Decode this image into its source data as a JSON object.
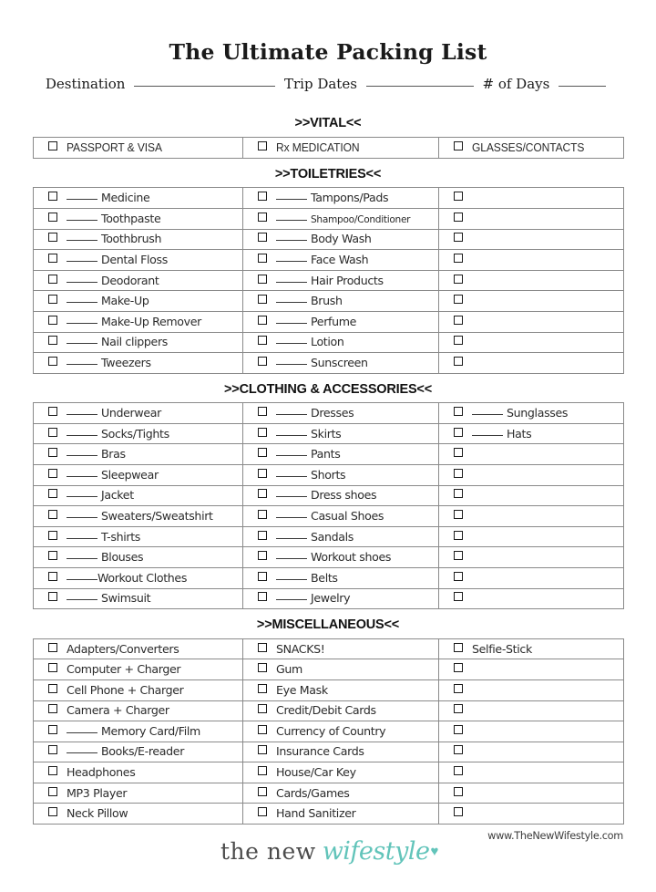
{
  "document": {
    "title": "The Ultimate Packing List",
    "meta": {
      "destination_label": "Destination",
      "trip_dates_label": "Trip Dates",
      "days_label": "# of Days",
      "destination_value": "",
      "trip_dates_value": "",
      "days_value": ""
    }
  },
  "sections": [
    {
      "id": "vital",
      "heading": ">>VITAL<<",
      "style": "caps",
      "rows": [
        [
          {
            "label": "PASSPORT & VISA",
            "blank": false
          },
          {
            "label": "Rx MEDICATION",
            "blank": false
          },
          {
            "label": "GLASSES/CONTACTS",
            "blank": false
          }
        ]
      ]
    },
    {
      "id": "toiletries",
      "heading": ">>TOILETRIES<<",
      "style": "normal",
      "rows": [
        [
          {
            "label": "Medicine",
            "blank": true
          },
          {
            "label": "Tampons/Pads",
            "blank": true
          },
          {
            "label": "",
            "blank": false
          }
        ],
        [
          {
            "label": "Toothpaste",
            "blank": true
          },
          {
            "label": "Shampoo/Conditioner",
            "blank": true,
            "small": true
          },
          {
            "label": "",
            "blank": false
          }
        ],
        [
          {
            "label": "Toothbrush",
            "blank": true
          },
          {
            "label": "Body Wash",
            "blank": true
          },
          {
            "label": "",
            "blank": false
          }
        ],
        [
          {
            "label": "Dental Floss",
            "blank": true
          },
          {
            "label": "Face Wash",
            "blank": true
          },
          {
            "label": "",
            "blank": false
          }
        ],
        [
          {
            "label": "Deodorant",
            "blank": true
          },
          {
            "label": "Hair Products",
            "blank": true
          },
          {
            "label": "",
            "blank": false
          }
        ],
        [
          {
            "label": "Make-Up",
            "blank": true
          },
          {
            "label": "Brush",
            "blank": true
          },
          {
            "label": "",
            "blank": false
          }
        ],
        [
          {
            "label": "Make-Up Remover",
            "blank": true
          },
          {
            "label": "Perfume",
            "blank": true
          },
          {
            "label": "",
            "blank": false
          }
        ],
        [
          {
            "label": "Nail clippers",
            "blank": true
          },
          {
            "label": "Lotion",
            "blank": true
          },
          {
            "label": "",
            "blank": false
          }
        ],
        [
          {
            "label": "Tweezers",
            "blank": true
          },
          {
            "label": "Sunscreen",
            "blank": true
          },
          {
            "label": "",
            "blank": false
          }
        ]
      ]
    },
    {
      "id": "clothing",
      "heading": ">>CLOTHING & ACCESSORIES<<",
      "style": "normal",
      "rows": [
        [
          {
            "label": "Underwear",
            "blank": true
          },
          {
            "label": "Dresses",
            "blank": true
          },
          {
            "label": "Sunglasses",
            "blank": true
          }
        ],
        [
          {
            "label": "Socks/Tights",
            "blank": true
          },
          {
            "label": "Skirts",
            "blank": true
          },
          {
            "label": "Hats",
            "blank": true
          }
        ],
        [
          {
            "label": "Bras",
            "blank": true
          },
          {
            "label": "Pants",
            "blank": true
          },
          {
            "label": "",
            "blank": false
          }
        ],
        [
          {
            "label": "Sleepwear",
            "blank": true
          },
          {
            "label": "Shorts",
            "blank": true
          },
          {
            "label": "",
            "blank": false
          }
        ],
        [
          {
            "label": "Jacket",
            "blank": true
          },
          {
            "label": "Dress shoes",
            "blank": true
          },
          {
            "label": "",
            "blank": false
          }
        ],
        [
          {
            "label": "Sweaters/Sweatshirt",
            "blank": true
          },
          {
            "label": "Casual Shoes",
            "blank": true
          },
          {
            "label": "",
            "blank": false
          }
        ],
        [
          {
            "label": "T-shirts",
            "blank": true
          },
          {
            "label": "Sandals",
            "blank": true
          },
          {
            "label": "",
            "blank": false
          }
        ],
        [
          {
            "label": "Blouses",
            "blank": true
          },
          {
            "label": "Workout shoes",
            "blank": true
          },
          {
            "label": "",
            "blank": false
          }
        ],
        [
          {
            "label": "Workout Clothes",
            "blank": true,
            "tight": true
          },
          {
            "label": "Belts",
            "blank": true
          },
          {
            "label": "",
            "blank": false
          }
        ],
        [
          {
            "label": "Swimsuit",
            "blank": true
          },
          {
            "label": "Jewelry",
            "blank": true
          },
          {
            "label": "",
            "blank": false
          }
        ]
      ]
    },
    {
      "id": "miscellaneous",
      "heading": ">>MISCELLANEOUS<<",
      "style": "normal",
      "rows": [
        [
          {
            "label": "Adapters/Converters",
            "blank": false
          },
          {
            "label": "SNACKS!",
            "blank": false
          },
          {
            "label": "Selfie-Stick",
            "blank": false
          }
        ],
        [
          {
            "label": "Computer + Charger",
            "blank": false
          },
          {
            "label": "Gum",
            "blank": false
          },
          {
            "label": "",
            "blank": false
          }
        ],
        [
          {
            "label": "Cell Phone + Charger",
            "blank": false
          },
          {
            "label": "Eye Mask",
            "blank": false
          },
          {
            "label": "",
            "blank": false
          }
        ],
        [
          {
            "label": "Camera + Charger",
            "blank": false
          },
          {
            "label": "Credit/Debit Cards",
            "blank": false
          },
          {
            "label": "",
            "blank": false
          }
        ],
        [
          {
            "label": "Memory Card/Film",
            "blank": true
          },
          {
            "label": "Currency of Country",
            "blank": false
          },
          {
            "label": "",
            "blank": false
          }
        ],
        [
          {
            "label": "Books/E-reader",
            "blank": true
          },
          {
            "label": "Insurance Cards",
            "blank": false
          },
          {
            "label": "",
            "blank": false
          }
        ],
        [
          {
            "label": "Headphones",
            "blank": false
          },
          {
            "label": "House/Car Key",
            "blank": false
          },
          {
            "label": "",
            "blank": false
          }
        ],
        [
          {
            "label": "MP3 Player",
            "blank": false
          },
          {
            "label": "Cards/Games",
            "blank": false
          },
          {
            "label": "",
            "blank": false
          }
        ],
        [
          {
            "label": "Neck Pillow",
            "blank": false
          },
          {
            "label": "Hand Sanitizer",
            "blank": false
          },
          {
            "label": "",
            "blank": false
          }
        ]
      ]
    }
  ],
  "footer": {
    "site_url": "www.TheNewWifestyle.com",
    "logo_primary": "the new",
    "logo_accent": "wifestyle",
    "logo_heart": "♥",
    "accent_color": "#62c4ba"
  }
}
